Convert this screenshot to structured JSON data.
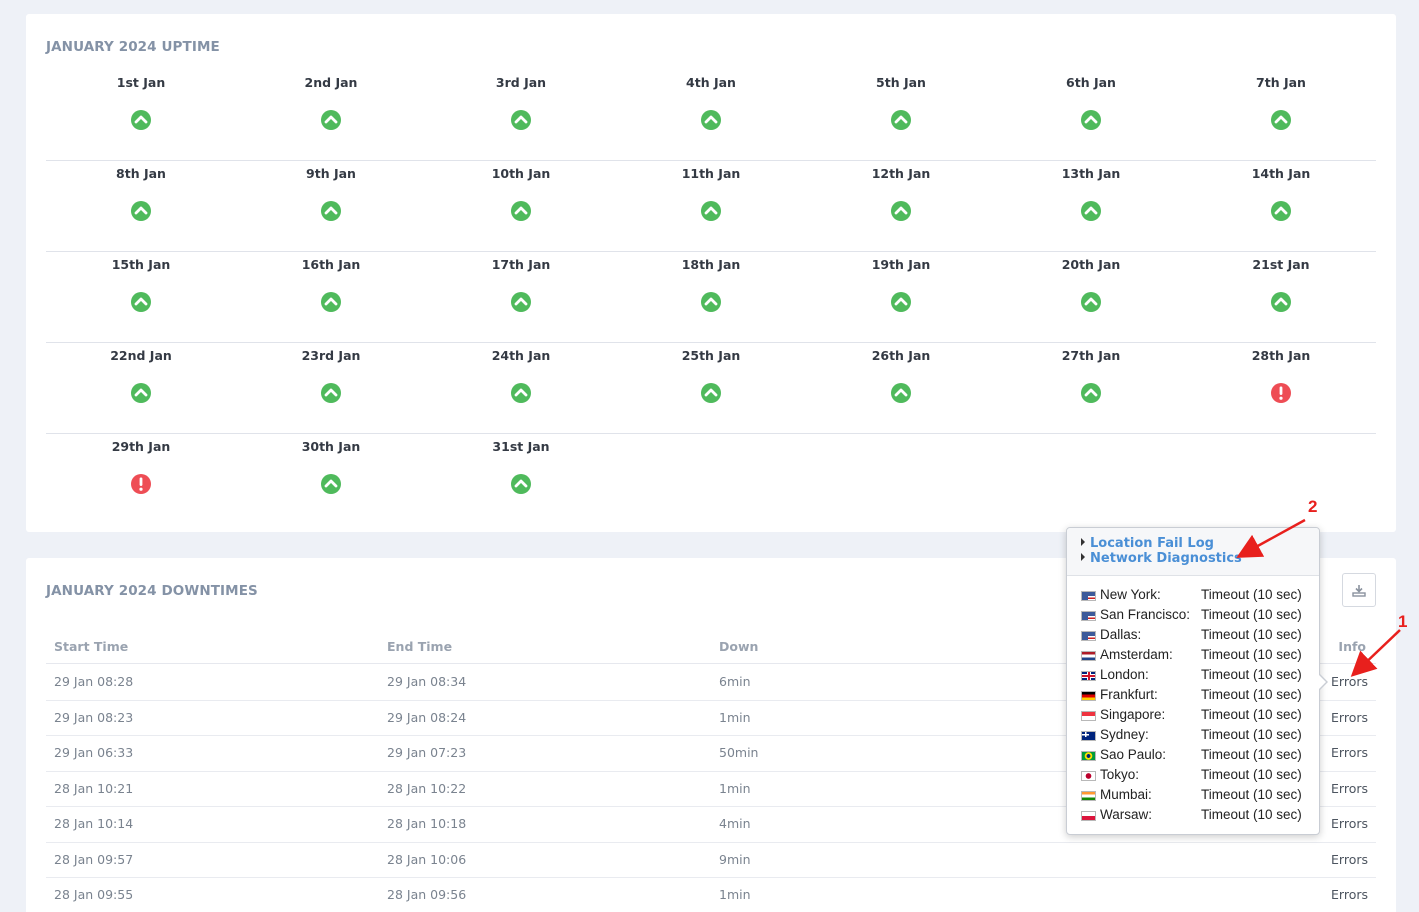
{
  "uptime": {
    "title": "JANUARY 2024 UPTIME",
    "days": [
      {
        "label": "1st Jan",
        "status": "up"
      },
      {
        "label": "2nd Jan",
        "status": "up"
      },
      {
        "label": "3rd Jan",
        "status": "up"
      },
      {
        "label": "4th Jan",
        "status": "up"
      },
      {
        "label": "5th Jan",
        "status": "up"
      },
      {
        "label": "6th Jan",
        "status": "up"
      },
      {
        "label": "7th Jan",
        "status": "up"
      },
      {
        "label": "8th Jan",
        "status": "up"
      },
      {
        "label": "9th Jan",
        "status": "up"
      },
      {
        "label": "10th Jan",
        "status": "up"
      },
      {
        "label": "11th Jan",
        "status": "up"
      },
      {
        "label": "12th Jan",
        "status": "up"
      },
      {
        "label": "13th Jan",
        "status": "up"
      },
      {
        "label": "14th Jan",
        "status": "up"
      },
      {
        "label": "15th Jan",
        "status": "up"
      },
      {
        "label": "16th Jan",
        "status": "up"
      },
      {
        "label": "17th Jan",
        "status": "up"
      },
      {
        "label": "18th Jan",
        "status": "up"
      },
      {
        "label": "19th Jan",
        "status": "up"
      },
      {
        "label": "20th Jan",
        "status": "up"
      },
      {
        "label": "21st Jan",
        "status": "up"
      },
      {
        "label": "22nd Jan",
        "status": "up"
      },
      {
        "label": "23rd Jan",
        "status": "up"
      },
      {
        "label": "24th Jan",
        "status": "up"
      },
      {
        "label": "25th Jan",
        "status": "up"
      },
      {
        "label": "26th Jan",
        "status": "up"
      },
      {
        "label": "27th Jan",
        "status": "up"
      },
      {
        "label": "28th Jan",
        "status": "down"
      },
      {
        "label": "29th Jan",
        "status": "down"
      },
      {
        "label": "30th Jan",
        "status": "up"
      },
      {
        "label": "31st Jan",
        "status": "up"
      }
    ]
  },
  "downtimes": {
    "title": "JANUARY 2024 DOWNTIMES",
    "columns": {
      "start": "Start Time",
      "end": "End Time",
      "down": "Down",
      "info": "Info"
    },
    "rows": [
      {
        "start": "29 Jan 08:28",
        "end": "29 Jan 08:34",
        "down": "6min",
        "info": "Errors"
      },
      {
        "start": "29 Jan 08:23",
        "end": "29 Jan 08:24",
        "down": "1min",
        "info": "Errors"
      },
      {
        "start": "29 Jan 06:33",
        "end": "29 Jan 07:23",
        "down": "50min",
        "info": "Errors"
      },
      {
        "start": "28 Jan 10:21",
        "end": "28 Jan 10:22",
        "down": "1min",
        "info": "Errors"
      },
      {
        "start": "28 Jan 10:14",
        "end": "28 Jan 10:18",
        "down": "4min",
        "info": "Errors"
      },
      {
        "start": "28 Jan 09:57",
        "end": "28 Jan 10:06",
        "down": "9min",
        "info": "Errors"
      },
      {
        "start": "28 Jan 09:55",
        "end": "28 Jan 09:56",
        "down": "1min",
        "info": "Errors"
      }
    ]
  },
  "popover": {
    "links": [
      "Location Fail Log",
      "Network Diagnostics"
    ],
    "locations": [
      {
        "name": "New York:",
        "status": "Timeout (10 sec)",
        "flag": "us"
      },
      {
        "name": "San Francisco:",
        "status": "Timeout (10 sec)",
        "flag": "us"
      },
      {
        "name": "Dallas:",
        "status": "Timeout (10 sec)",
        "flag": "us"
      },
      {
        "name": "Amsterdam:",
        "status": "Timeout (10 sec)",
        "flag": "nl"
      },
      {
        "name": "London:",
        "status": "Timeout (10 sec)",
        "flag": "gb"
      },
      {
        "name": "Frankfurt:",
        "status": "Timeout (10 sec)",
        "flag": "de"
      },
      {
        "name": "Singapore:",
        "status": "Timeout (10 sec)",
        "flag": "sg"
      },
      {
        "name": "Sydney:",
        "status": "Timeout (10 sec)",
        "flag": "au"
      },
      {
        "name": "Sao Paulo:",
        "status": "Timeout (10 sec)",
        "flag": "br"
      },
      {
        "name": "Tokyo:",
        "status": "Timeout (10 sec)",
        "flag": "jp"
      },
      {
        "name": "Mumbai:",
        "status": "Timeout (10 sec)",
        "flag": "in"
      },
      {
        "name": "Warsaw:",
        "status": "Timeout (10 sec)",
        "flag": "pl"
      }
    ]
  },
  "annotations": {
    "marker1": "1",
    "marker2": "2"
  },
  "colors": {
    "up": "#4fba5c",
    "down": "#ee4d55",
    "link": "#4a8fd6",
    "annotation": "#e8201d"
  }
}
